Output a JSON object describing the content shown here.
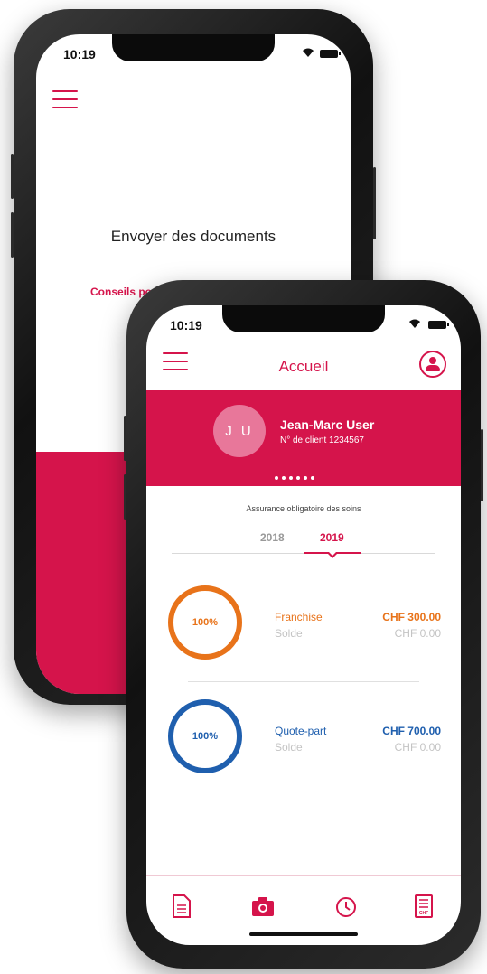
{
  "back_screen": {
    "status_time": "10:19",
    "title": "Envoyer des documents",
    "link_text": "Conseils po"
  },
  "front_screen": {
    "status_time": "10:19",
    "header": {
      "title": "Accueil",
      "menu_icon": "hamburger-menu-icon",
      "profile_icon": "user-profile-icon"
    },
    "user": {
      "initials": "J U",
      "name": "Jean-Marc User",
      "client_number": "N° de client 1234567"
    },
    "carousel_dots": 6,
    "section_label": "Assurance obligatoire des soins",
    "year_tabs": [
      {
        "label": "2018",
        "selected": false
      },
      {
        "label": "2019",
        "selected": true
      }
    ],
    "rings": [
      {
        "percent_label": "100%",
        "progress": 1.0,
        "label": "Franchise",
        "sub_label": "Solde",
        "amount": "CHF 300.00",
        "balance": "CHF 0.00",
        "color": "#e8731a"
      },
      {
        "percent_label": "100%",
        "progress": 1.0,
        "label": "Quote-part",
        "sub_label": "Solde",
        "amount": "CHF 700.00",
        "balance": "CHF 0.00",
        "color": "#1f5fae"
      }
    ],
    "bottom_nav": [
      {
        "icon": "document-icon"
      },
      {
        "icon": "camera-icon"
      },
      {
        "icon": "clock-icon"
      },
      {
        "icon": "chf-invoice-icon"
      }
    ]
  },
  "colors": {
    "accent": "#d5144b",
    "franchise": "#e8731a",
    "quote_part": "#1f5fae"
  }
}
